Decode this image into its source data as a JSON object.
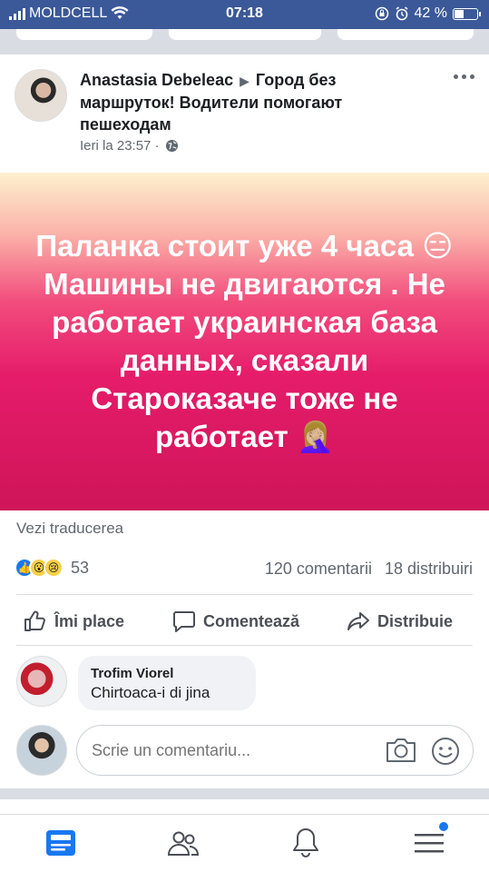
{
  "status_bar": {
    "carrier": "MOLDCELL",
    "time": "07:18",
    "battery": "42 %",
    "battery_level": 0.42
  },
  "post": {
    "author": "Anastasia Debeleac",
    "target": "Город без маршруток! Водители помогают пешеходам",
    "timestamp": "Ieri la 23:57 ·",
    "status_text": "Паланка стоит уже 4 часа 😑 Машины не двигаются . Не работает украинская база данных, сказали Староказаче тоже не работает 🤦🏼‍♀️",
    "see_translation": "Vezi traducerea",
    "reaction_count": "53",
    "comments_count": "120 comentarii",
    "shares_count": "18 distribuiri",
    "colors": {
      "status_top": "#fdf1cf",
      "status_bottom": "#cf1559",
      "like_blue": "#1877f2"
    }
  },
  "actions": {
    "like": "Îmi place",
    "comment": "Comentează",
    "share": "Distribuie"
  },
  "comment": {
    "author": "Trofim Viorel",
    "text": "Chirtoaca-i di jina"
  },
  "comment_input": {
    "placeholder": "Scrie un comentariu..."
  },
  "bottom_nav": {
    "items": [
      "news-feed-icon",
      "friends-icon",
      "notifications-icon",
      "menu-icon"
    ]
  }
}
